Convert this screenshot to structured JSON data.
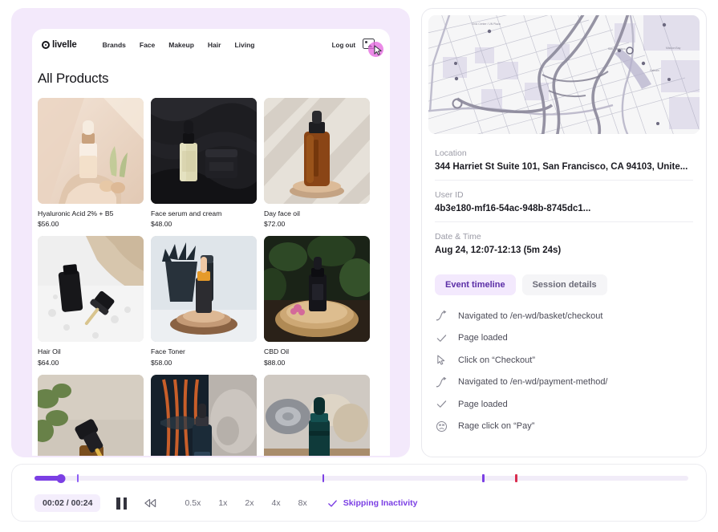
{
  "replay_site": {
    "brand": "livelle",
    "brand_mark_icon": "target-circle-icon",
    "nav_links": [
      "Brands",
      "Face",
      "Makeup",
      "Hair",
      "Living"
    ],
    "logout_label": "Log out",
    "cart_icon": "shopping-bag-icon",
    "cursor_icon": "mouse-cursor-icon",
    "page_title": "All Products",
    "products": [
      {
        "name": "Hyaluronic Acid 2% + B5",
        "price": "$56.00",
        "image": "serum-dropper-on-stone-beige"
      },
      {
        "name": "Face serum and cream",
        "price": "$48.00",
        "image": "serum-and-jar-on-black-fabric"
      },
      {
        "name": "Day face oil",
        "price": "$72.00",
        "image": "amber-bottle-striped-shadow"
      },
      {
        "name": "Hair Oil",
        "price": "$64.00",
        "image": "black-dropper-bottle-wet-surface"
      },
      {
        "name": "Face Toner",
        "price": "$58.00",
        "image": "dropper-on-wood-slice-with-plant"
      },
      {
        "name": "CBD Oil",
        "price": "$88.00",
        "image": "dark-bottle-on-tree-stump-greenery"
      },
      {
        "name": "",
        "price": "",
        "image": "dropper-with-green-leaves"
      },
      {
        "name": "",
        "price": "",
        "image": "bottle-with-statue-and-orange-cords"
      },
      {
        "name": "",
        "price": "",
        "image": "teal-dropper-with-rolled-towels"
      }
    ]
  },
  "detail": {
    "map_icon": "street-map",
    "fields": [
      {
        "label": "Location",
        "value": "344 Harriet St Suite 101, San Francisco, CA 94103, Unite..."
      },
      {
        "label": "User ID",
        "value": "4b3e180-mf16-54ac-948b-8745dc1..."
      },
      {
        "label": "Date & Time",
        "value": "Aug 24, 12:07-12:13 (5m 24s)"
      }
    ],
    "tabs": [
      {
        "label": "Event timeline",
        "active": true
      },
      {
        "label": "Session details",
        "active": false
      }
    ],
    "events": [
      {
        "icon": "navigate-icon",
        "text": "Navigated to /en-wd/basket/checkout"
      },
      {
        "icon": "check-icon",
        "text": "Page loaded"
      },
      {
        "icon": "cursor-click-icon",
        "text": "Click on “Checkout”"
      },
      {
        "icon": "navigate-icon",
        "text": "Navigated to /en-wd/payment-method/"
      },
      {
        "icon": "check-icon",
        "text": "Page loaded"
      },
      {
        "icon": "rage-face-icon",
        "text": "Rage click on “Pay”"
      }
    ]
  },
  "playback": {
    "time": "00:02 / 00:24",
    "progress_percent": 4,
    "handle_percent": 4,
    "pause_icon": "pause-icon",
    "rewind_icon": "rewind-icon",
    "speeds": [
      "0.5x",
      "1x",
      "2x",
      "4x",
      "8x"
    ],
    "skip_check_icon": "check-icon",
    "skip_label": "Skipping Inactivity",
    "markers": [
      {
        "percent": 6.5,
        "color": "#8b5cf6"
      },
      {
        "percent": 44,
        "color": "#7b3fe4"
      },
      {
        "percent": 68.5,
        "color": "#7b3fe4"
      },
      {
        "percent": 73.5,
        "color": "#d92d4e"
      }
    ],
    "accent_color": "#7b3fe4",
    "track_color": "#f1ecf8"
  }
}
